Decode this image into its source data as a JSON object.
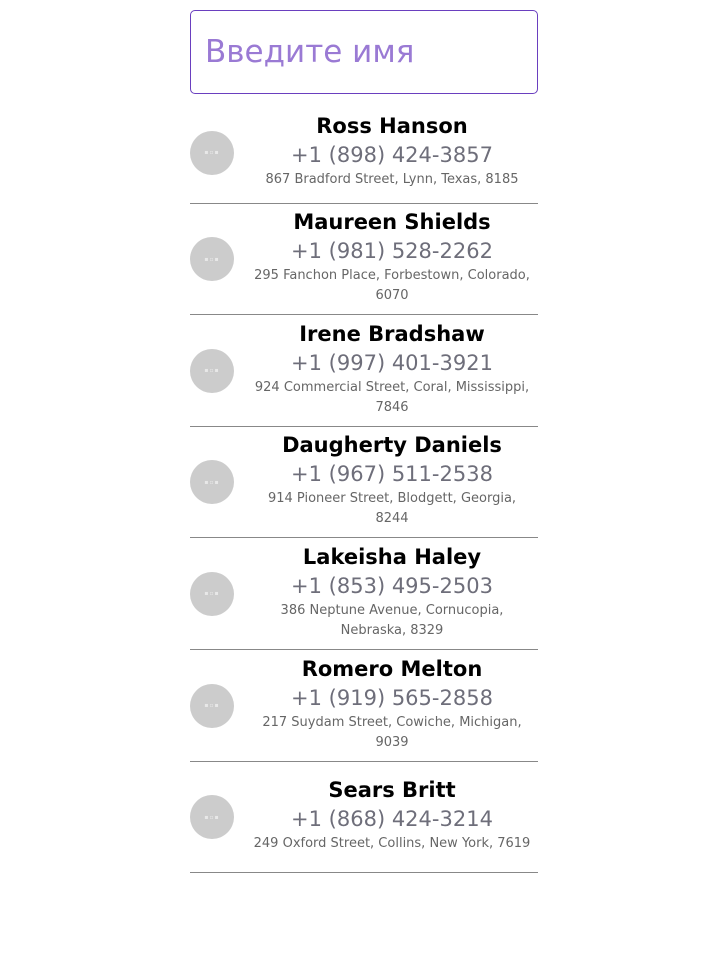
{
  "search": {
    "placeholder": "Введите имя",
    "value": ""
  },
  "contacts": [
    {
      "name": "Ross Hanson",
      "phone": "+1 (898) 424-3857",
      "address": "867 Bradford Street, Lynn, Texas, 8185",
      "avatar_icon": "avatar-placeholder-icon"
    },
    {
      "name": "Maureen Shields",
      "phone": "+1 (981) 528-2262",
      "address": "295 Fanchon Place, Forbestown, Colorado, 6070",
      "avatar_icon": "avatar-placeholder-icon"
    },
    {
      "name": "Irene Bradshaw",
      "phone": "+1 (997) 401-3921",
      "address": "924 Commercial Street, Coral, Mississippi, 7846",
      "avatar_icon": "avatar-placeholder-icon"
    },
    {
      "name": "Daugherty Daniels",
      "phone": "+1 (967) 511-2538",
      "address": "914 Pioneer Street, Blodgett, Georgia, 8244",
      "avatar_icon": "avatar-placeholder-icon"
    },
    {
      "name": "Lakeisha Haley",
      "phone": "+1 (853) 495-2503",
      "address": "386 Neptune Avenue, Cornucopia, Nebraska, 8329",
      "avatar_icon": "avatar-placeholder-icon"
    },
    {
      "name": "Romero Melton",
      "phone": "+1 (919) 565-2858",
      "address": "217 Suydam Street, Cowiche, Michigan, 9039",
      "avatar_icon": "avatar-placeholder-icon"
    },
    {
      "name": "Sears Britt",
      "phone": "+1 (868) 424-3214",
      "address": "249 Oxford Street, Collins, New York, 7619",
      "avatar_icon": "avatar-placeholder-icon"
    }
  ]
}
